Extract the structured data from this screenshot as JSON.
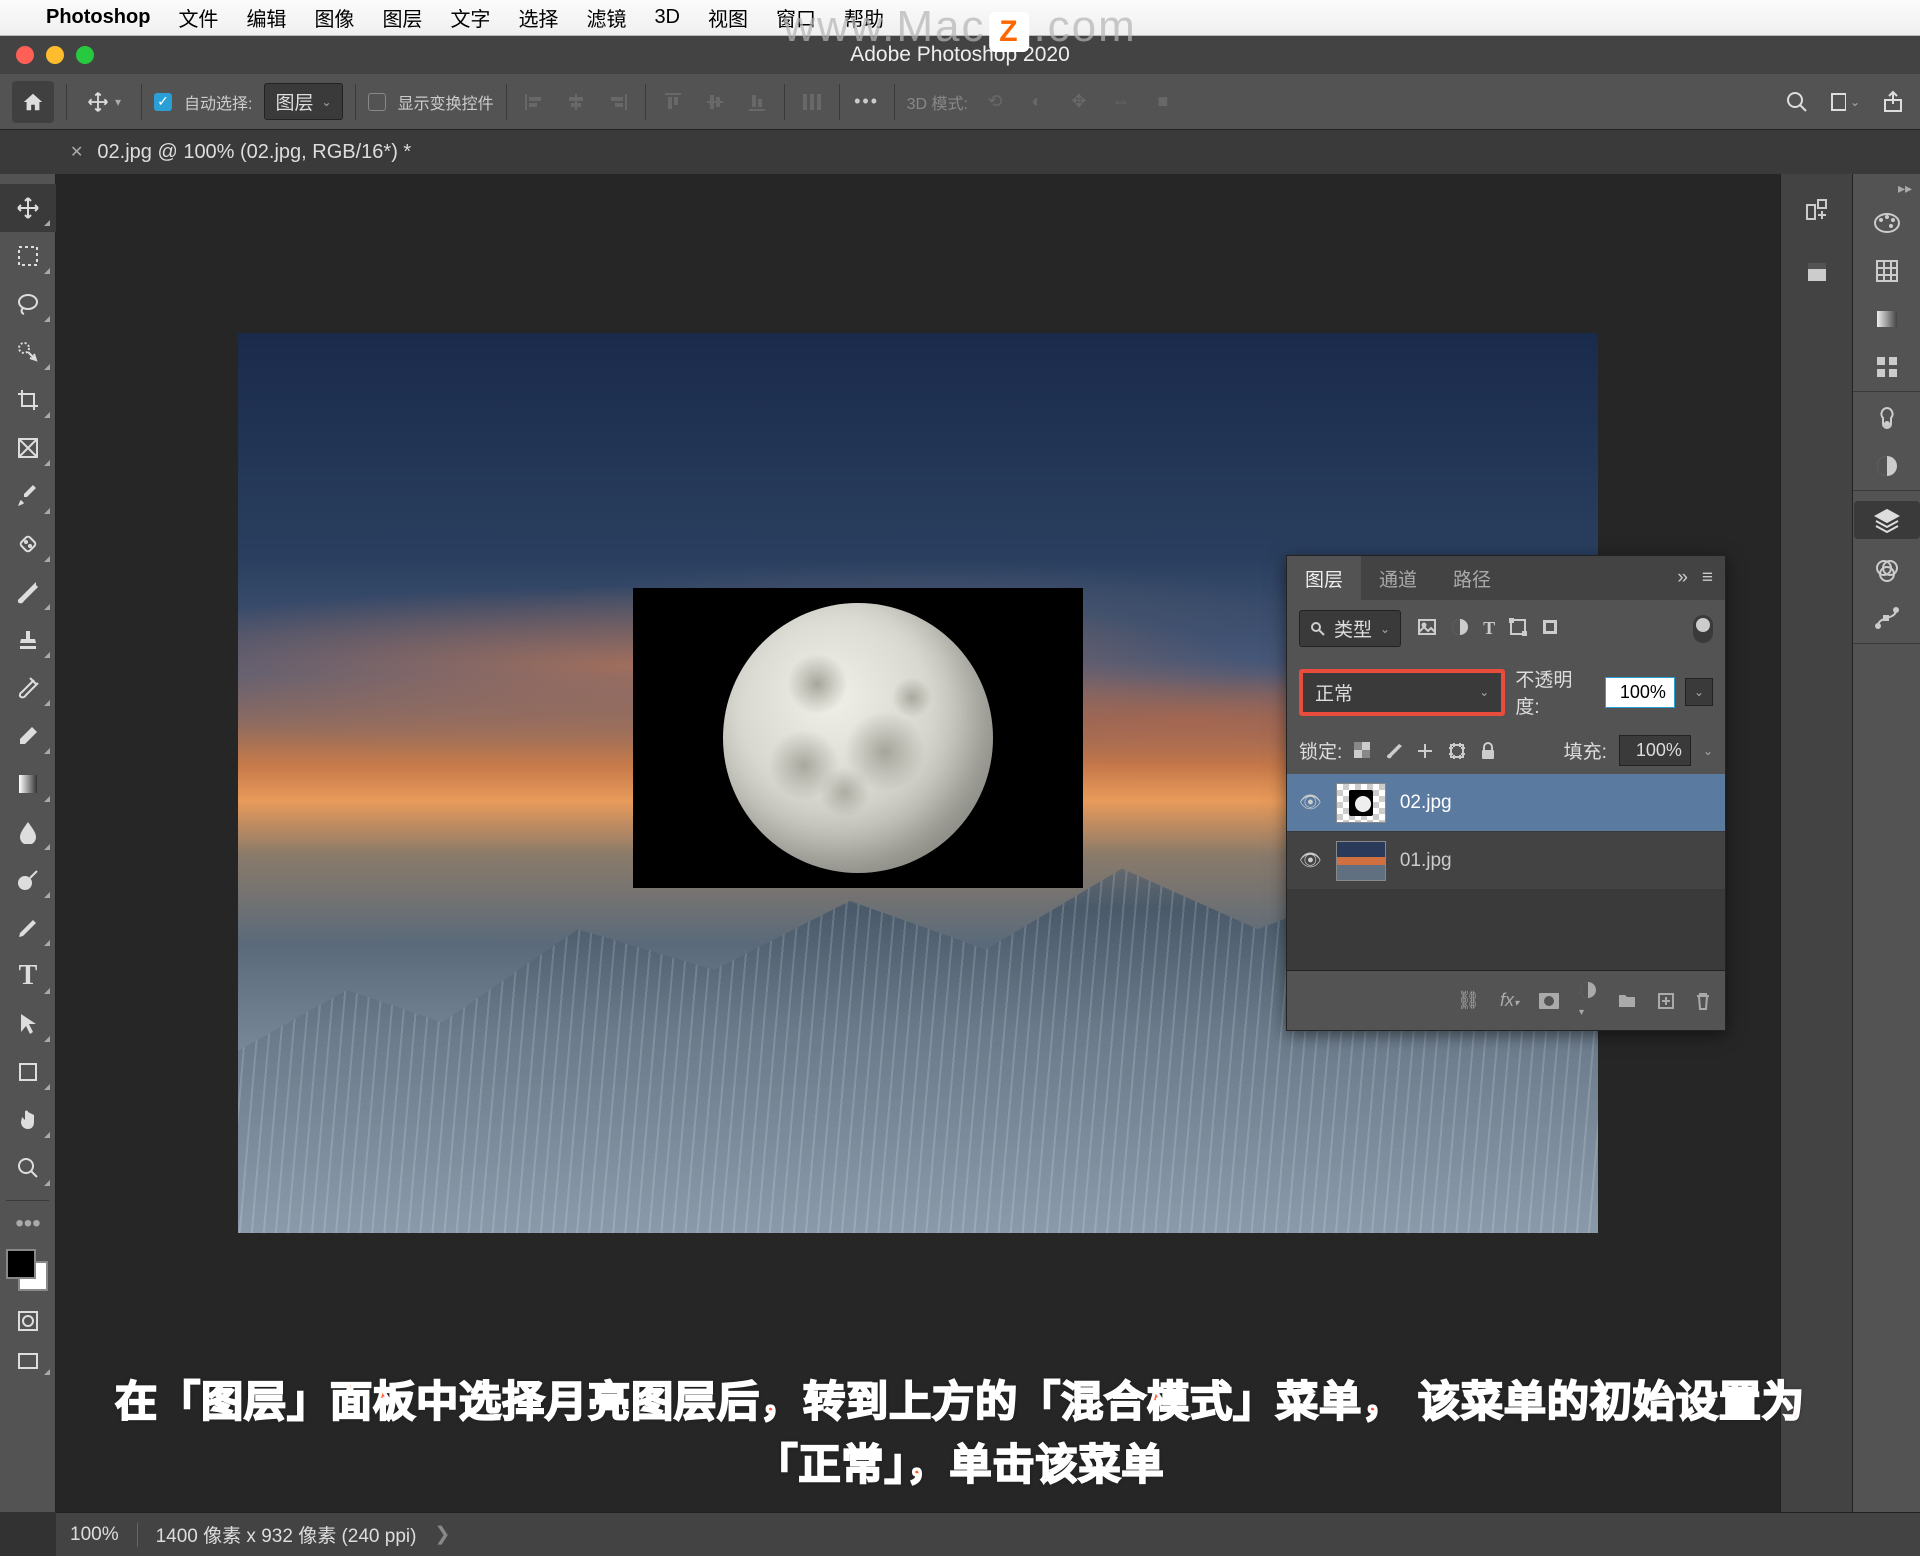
{
  "mac_menu": {
    "app_name": "Photoshop",
    "items": [
      "文件",
      "编辑",
      "图像",
      "图层",
      "文字",
      "选择",
      "滤镜",
      "3D",
      "视图",
      "窗口",
      "帮助"
    ]
  },
  "window": {
    "title": "Adobe Photoshop 2020"
  },
  "watermark": "www.Mac .com",
  "options_bar": {
    "auto_select": "自动选择:",
    "layer_select": "图层",
    "show_transform": "显示变换控件",
    "mode_3d": "3D 模式:"
  },
  "doc_tab": {
    "label": "02.jpg @ 100% (02.jpg, RGB/16*) *"
  },
  "layers_panel": {
    "tabs": [
      "图层",
      "通道",
      "路径"
    ],
    "kind_label": "类型",
    "blend_mode": "正常",
    "opacity_label": "不透明度:",
    "opacity_value": "100%",
    "lock_label": "锁定:",
    "fill_label": "填充:",
    "fill_value": "100%",
    "layers": [
      {
        "name": "02.jpg",
        "selected": true
      },
      {
        "name": "01.jpg",
        "selected": false
      }
    ]
  },
  "status": {
    "zoom": "100%",
    "dims": "1400 像素 x 932 像素 (240 ppi)"
  },
  "annotation": {
    "line1": "在「图层」面板中选择月亮图层后，转到上方的「混合模式」菜单，  该菜单的初始设置为",
    "line2": "「正常」，单击该菜单"
  }
}
